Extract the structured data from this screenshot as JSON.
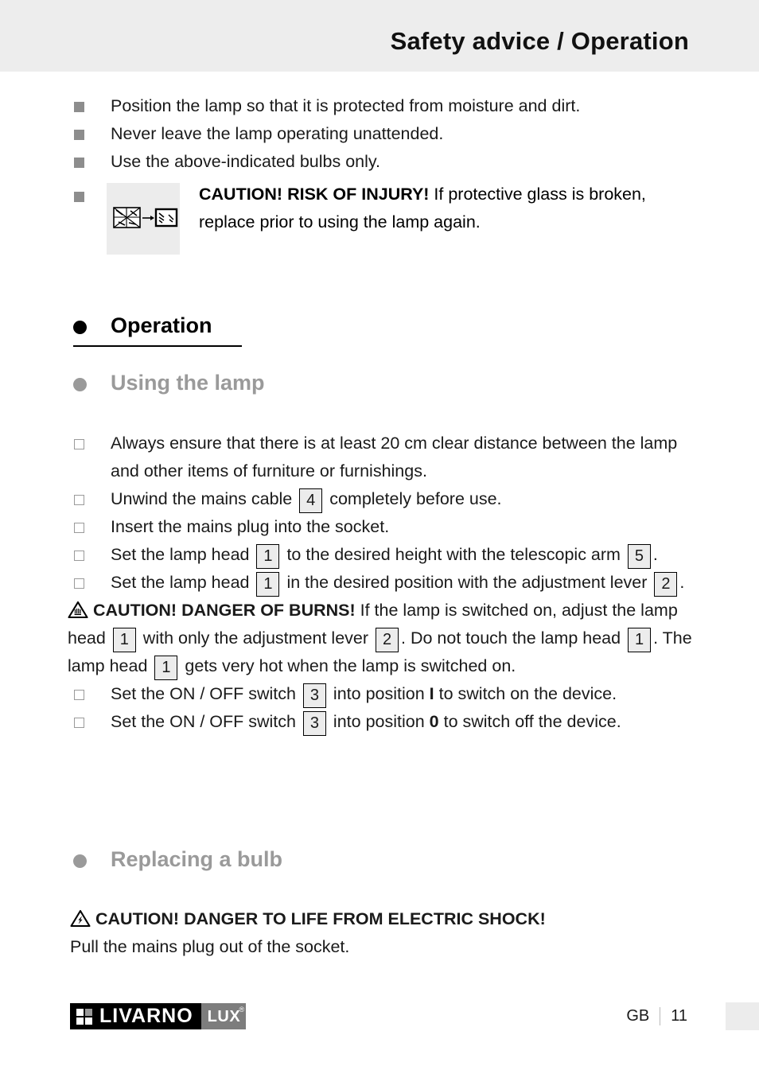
{
  "header": {
    "title": "Safety advice / Operation",
    "band_color": "#ededed"
  },
  "safety_bullets": [
    "Position the lamp so that it is protected from moisture and dirt.",
    "Never leave the lamp operating unattended.",
    "Use the above-indicated bulbs only."
  ],
  "glass_caution": {
    "icon_name": "broken-glass-replacement-pictogram",
    "heading": "CAUTION! RISK OF INJURY!",
    "body": " If protective glass is broken, replace prior to using the lamp again."
  },
  "sections": {
    "operation": {
      "title": "Operation",
      "color": "#000000"
    },
    "using_the_lamp": {
      "title": "Using the lamp",
      "color": "#9a9a9a"
    },
    "replacing_a_bulb": {
      "title": "Replacing a bulb",
      "color": "#9a9a9a"
    }
  },
  "using_lamp_steps": {
    "step1": {
      "text": "Always ensure that there is at least 20 cm clear distance between the lamp and other items of furniture or furnishings."
    },
    "step2": {
      "pre": "Unwind the mains cable ",
      "ref": "4",
      "post": " completely before use."
    },
    "step3": {
      "text": "Insert the mains plug into the socket."
    },
    "step4": {
      "pre": "Set the lamp head ",
      "ref1": "1",
      "mid": " to the desired height with the telescopic arm ",
      "ref2": "5",
      "post": "."
    },
    "step5": {
      "pre": "Set the lamp head ",
      "ref1": "1",
      "mid": " in the desired position with the adjustment lever ",
      "ref2": "2",
      "post": "."
    },
    "step6": {
      "pre": "Set the ON / OFF switch ",
      "ref": "3",
      "mid": " into position ",
      "position": "I",
      "post": " to switch on the device."
    },
    "step7": {
      "pre": "Set the ON / OFF switch ",
      "ref": "3",
      "mid": " into position ",
      "position": "0",
      "post": " to switch off the device."
    }
  },
  "burns_caution": {
    "icon_name": "warning-triangle-hot-surface-icon",
    "heading": "CAUTION! DANGER OF BURNS!",
    "part1": " If the lamp is switched on, adjust the lamp head ",
    "ref1": "1",
    "part2": " with only the adjustment lever ",
    "ref2": "2",
    "part3": ". Do not touch the lamp head ",
    "ref3": "1",
    "part4": ". The lamp head ",
    "ref4": "1",
    "part5": " gets very hot when the lamp is switched on."
  },
  "shock_caution": {
    "icon_name": "warning-triangle-electric-shock-icon",
    "heading": "CAUTION! DANGER TO LIFE FROM ELECTRIC SHOCK!",
    "body": "Pull the mains plug out of the socket."
  },
  "footer": {
    "logo_primary": "LIVARNO",
    "logo_secondary": "LUX",
    "logo_registered": "®",
    "country_code": "GB",
    "page_number": "11"
  }
}
